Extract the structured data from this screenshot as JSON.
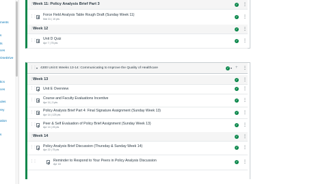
{
  "left_nav": [
    "ments",
    "s",
    "ts",
    "ces",
    "OneDrive",
    "tics",
    "ces",
    "ules",
    "rey",
    "ation",
    "s"
  ],
  "top_section": {
    "rows": [
      {
        "kind": "header",
        "title": "Week 11: Policy Analysis Brief Part 3"
      },
      {
        "kind": "item",
        "title": "Force Field Analysis Table Rough Draft (Sunday Week 11)",
        "meta": "Mar 31 | 10 pts"
      },
      {
        "kind": "header",
        "title": "Week 12"
      },
      {
        "kind": "item",
        "title": "Unit D Quiz",
        "meta": "Apr 7 | 75 pts"
      }
    ]
  },
  "main_module": {
    "title": "4300 Unit E Weeks 13-14: Communicating to Improve the Quality of Healthcare",
    "rows": [
      {
        "kind": "header",
        "title": "Week 13"
      },
      {
        "kind": "item",
        "title": "Unit E Overview",
        "meta": ""
      },
      {
        "kind": "item",
        "title": "Course and Faculty Evaluations Incentive",
        "meta": "Apr 11 | 3 pts"
      },
      {
        "kind": "item",
        "title": "Policy Analysis Brief Part 4: Final Signature Assignment (Sunday Week 13)",
        "meta": "Apr 14 | 125 pts"
      },
      {
        "kind": "item",
        "title": "Peer & Self Evaluation of Policy Brief Assignment (Sunday Week 13)",
        "meta": "Apr 14 | 25 pts"
      },
      {
        "kind": "header",
        "title": "Week 14"
      },
      {
        "kind": "item",
        "title": "Policy Analysis Brief Discussion (Thursday & Sunday Week 14)",
        "meta": "Apr 22 | 75 pts"
      },
      {
        "kind": "subitem",
        "title": "Reminder to Respond to Your Peers in Policy Analysis Discussion",
        "meta": "Apr 18"
      }
    ]
  },
  "icons": {
    "drag": "drag-handle-icon",
    "check": "published-check-icon",
    "more": "kebab-menu-icon"
  },
  "colors": {
    "published": "#0b874b",
    "link": "#0374b5",
    "text": "#2d3b45"
  }
}
